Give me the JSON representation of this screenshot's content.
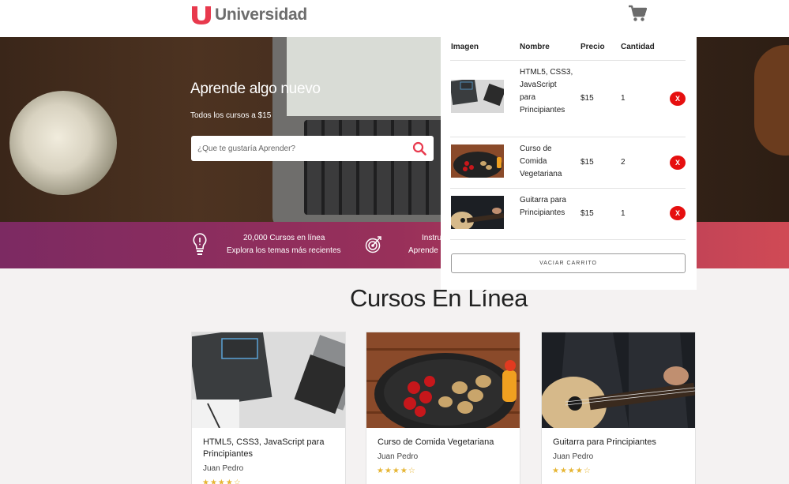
{
  "header": {
    "brand_mark": "U",
    "brand_name": "Universidad"
  },
  "hero": {
    "title": "Aprende algo nuevo",
    "subtitle": "Todos los cursos a $15",
    "search_placeholder": "¿Que te gustaría Aprender?"
  },
  "infobar": {
    "items": [
      {
        "line1": "20,000 Cursos en línea",
        "line2": "Explora los temas más recientes",
        "icon": "lightbulb-icon"
      },
      {
        "line1": "Instru",
        "line2": "Aprende",
        "icon": "target-icon"
      }
    ]
  },
  "section": {
    "title": "Cursos En Línea"
  },
  "courses": [
    {
      "title": "HTML5, CSS3, JavaScript para Principiantes",
      "author": "Juan Pedro",
      "rating": 4.5,
      "stars": "★★★★☆"
    },
    {
      "title": "Curso de Comida Vegetariana",
      "author": "Juan Pedro",
      "rating": 4.5,
      "stars": "★★★★☆"
    },
    {
      "title": "Guitarra para Principiantes",
      "author": "Juan Pedro",
      "rating": 4.5,
      "stars": "★★★★☆"
    }
  ],
  "cart": {
    "headers": {
      "image": "Imagen",
      "name": "Nombre",
      "price": "Precio",
      "quantity": "Cantidad"
    },
    "items": [
      {
        "name": "HTML5, CSS3, JavaScript para Principiantes",
        "price": "$15",
        "quantity": "1",
        "remove": "X"
      },
      {
        "name": "Curso de Comida Vegetariana",
        "price": "$15",
        "quantity": "2",
        "remove": "X"
      },
      {
        "name": "Guitarra para Principiantes",
        "price": "$15",
        "quantity": "1",
        "remove": "X"
      }
    ],
    "empty_label": "VACIAR CARRITO"
  },
  "colors": {
    "brand_red": "#e8394d",
    "remove_red": "#e60f0f",
    "infobar_start": "#7c2a62",
    "infobar_end": "#d04a55",
    "star": "#e6b533"
  }
}
